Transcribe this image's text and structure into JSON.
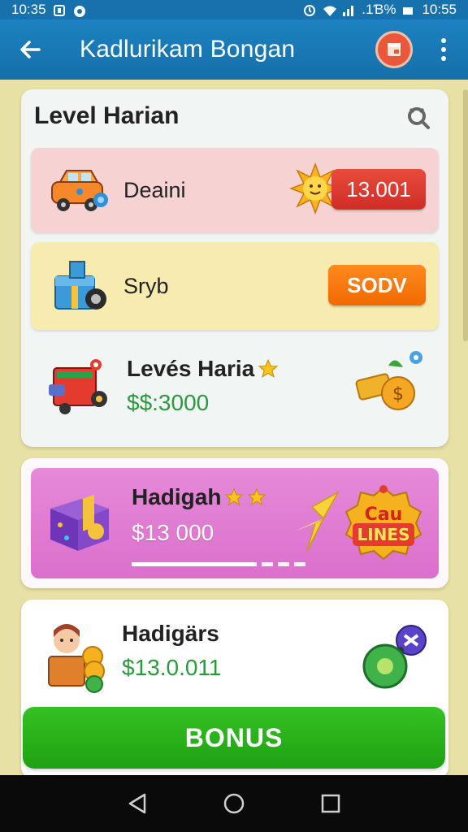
{
  "status_bar": {
    "time_left": "10:35",
    "battery": ".1Ɓ%",
    "time_right": "10:55"
  },
  "app_bar": {
    "title": "Kadlurikam Bongan"
  },
  "daily": {
    "title": "Level Harian",
    "rows": [
      {
        "label": "Deaini",
        "action": "13.001"
      },
      {
        "label": "Sryb",
        "action": "SODV"
      }
    ],
    "level_item": {
      "label": "Levés Haria",
      "amount": "$$:3000"
    }
  },
  "gift": {
    "label": "Hadigah",
    "amount": "$13 000",
    "badge_top": "Cau",
    "badge_bottom": "LINES",
    "progress": 0.7
  },
  "bonus": {
    "label": "Hadigärs",
    "amount": "$13.0.011",
    "button": "BONUS"
  },
  "colors": {
    "primary": "#1671ad",
    "accent_red": "#cf2d25",
    "accent_orange": "#f06a00",
    "money_green": "#2a9a3c",
    "bonus_green": "#1fa112",
    "gift_pink": "#db6fcd"
  },
  "icons": {
    "back": "arrow-left-icon",
    "store": "store-icon",
    "menu": "more-vertical-icon",
    "search": "search-icon",
    "car": "car-icon",
    "machine": "gift-machine-icon",
    "truck": "toy-truck-icon",
    "sun": "sun-icon",
    "coins": "coins-icon",
    "gift_box": "gift-box-icon",
    "bow": "bow-icon",
    "character": "character-icon",
    "plug": "plug-icon"
  }
}
